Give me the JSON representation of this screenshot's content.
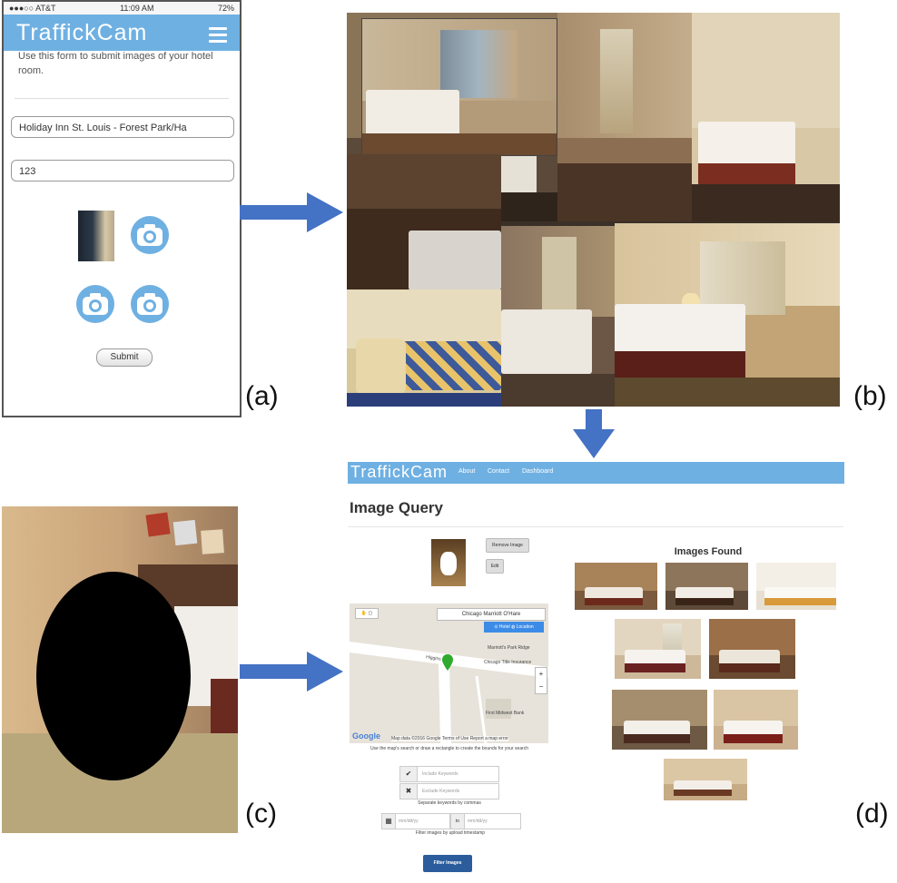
{
  "phone": {
    "status_carrier": "●●●○○ AT&T",
    "status_time": "11:09 AM",
    "status_battery": "72%",
    "app_logo": "TraffickCam",
    "intro_text": "Use this form to submit images of your hotel room.",
    "hotel_field_value": "Holiday Inn St. Louis - Forest Park/Ha",
    "room_field_value": "123",
    "submit_label": "Submit"
  },
  "captions": {
    "a": "(a)",
    "b": "(b)",
    "c": "(c)",
    "d": "(d)"
  },
  "web": {
    "logo": "TraffickCam",
    "nav_links": [
      "About",
      "Contact",
      "Dashboard"
    ],
    "page_title": "Image Query",
    "remove_image_label": "Remove Image",
    "edit_label": "Edit",
    "map": {
      "search_value": "Chicago Marriott O'Hare",
      "hotel_location_label": "⊙ Hotel ◍ Location",
      "place_1": "Marriott's Park Ridge",
      "place_2": "Chicago Title Insurance",
      "road": "Higgins Rd",
      "place_3": "First Midwest Bank",
      "zoom_in": "+",
      "zoom_out": "−",
      "google": "Google",
      "footer": "Map data ©2016 Google   Terms of Use   Report a map error"
    },
    "map_hint": "Use the map's search or draw a rectangle to create the bounds for your search",
    "include_keywords_placeholder": "Include Keywords",
    "exclude_keywords_placeholder": "Exclude Keywords",
    "keywords_hint": "Separate keywords by commas",
    "date_from_placeholder": "mm/dd/yy",
    "date_to_label": "to",
    "date_to_placeholder": "mm/dd/yy",
    "timestamp_hint": "Filter images by upload timestamp",
    "filter_button": "Filter Images",
    "images_found_title": "Images Found"
  },
  "colors": {
    "brand_blue": "#6fb0e2",
    "arrow_blue": "#4472c4",
    "filter_button": "#2b5d9c"
  }
}
